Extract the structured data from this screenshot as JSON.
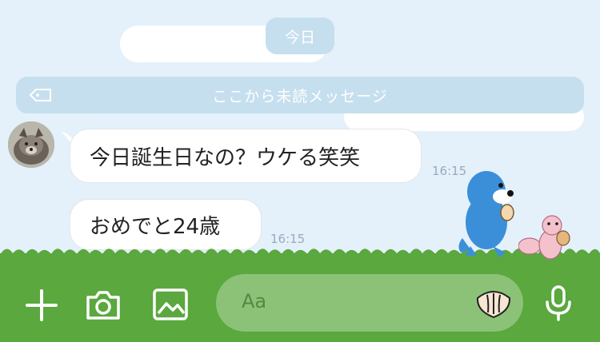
{
  "date_label": "今日",
  "unread_label": "ここから未読メッセージ",
  "messages": [
    {
      "text": "今日誕生日なの？ウケる笑笑",
      "time": "16:15"
    },
    {
      "text": "おめでと24歳",
      "time": "16:15"
    }
  ],
  "composer": {
    "placeholder": "Aa"
  },
  "colors": {
    "grass": "#5aa83e",
    "input_bg": "#8cc277",
    "bubble_bg": "#ffffff",
    "pill_bg": "#c6dfee"
  },
  "toolbar_icons": [
    "plus-icon",
    "camera-icon",
    "image-icon",
    "sticker-icon",
    "microphone-icon"
  ]
}
